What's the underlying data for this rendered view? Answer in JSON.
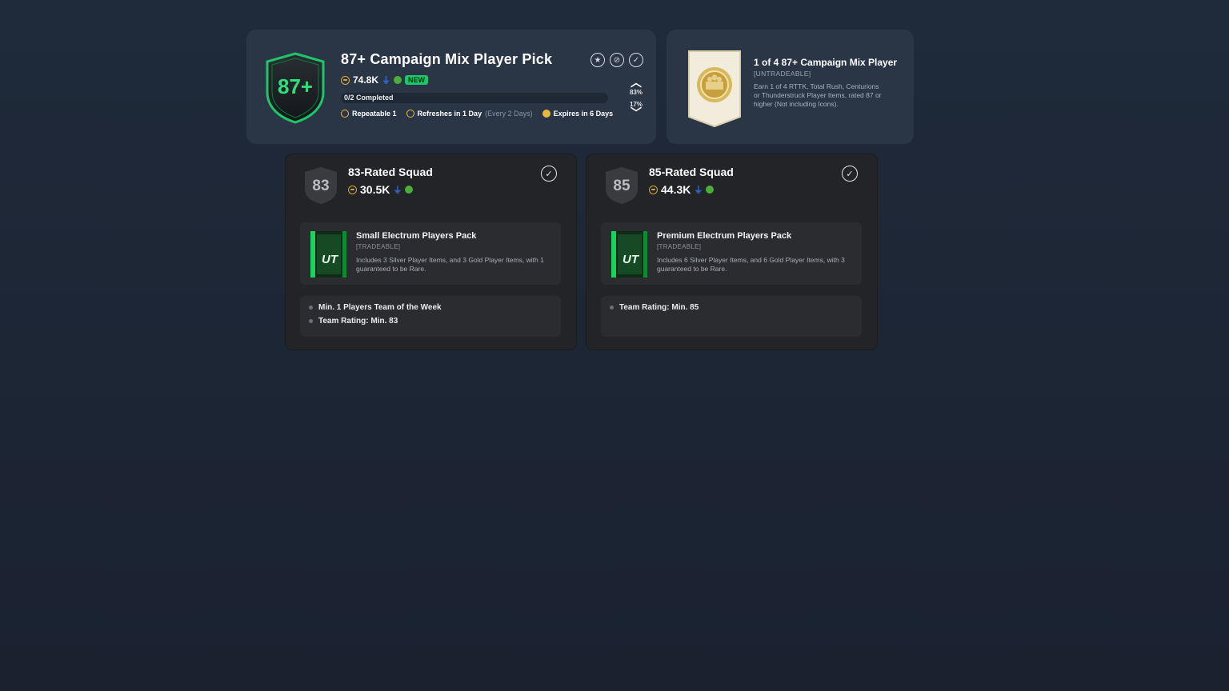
{
  "header": {
    "badge_text": "87+",
    "title": "87+ Campaign Mix Player Pick",
    "cost": "74.8K",
    "new_label": "NEW",
    "progress_text": "0/2 Completed",
    "progress_fraction": 0,
    "repeatable": "Repeatable 1",
    "refreshes": "Refreshes in 1 Day",
    "refresh_every": "(Every 2 Days)",
    "expires": "Expires in 6 Days",
    "vote_up_pct": "83%",
    "vote_down_pct": "17%",
    "icons": [
      "star-circle-icon",
      "hidden-circle-icon",
      "check-circle-icon"
    ]
  },
  "reward": {
    "title": "1 of 4 87+ Campaign Mix Player",
    "tradeable": "[UNTRADEABLE]",
    "description": "Earn 1 of 4 RTTK, Total Rush, Centurions or Thunderstruck Player Items, rated 87 or higher (Not including Icons)."
  },
  "squads": [
    {
      "rating": "83",
      "title": "83-Rated Squad",
      "cost": "30.5K",
      "pack": {
        "title": "Small Electrum Players Pack",
        "tradeable": "[TRADEABLE]",
        "description": "Includes 3 Silver Player Items, and 3 Gold Player Items, with 1 guaranteed to be Rare."
      },
      "requirements": [
        "Min. 1 Players Team of the Week",
        "Team Rating: Min. 83"
      ]
    },
    {
      "rating": "85",
      "title": "85-Rated Squad",
      "cost": "44.3K",
      "pack": {
        "title": "Premium Electrum Players Pack",
        "tradeable": "[TRADEABLE]",
        "description": "Includes 6 Silver Player Items, and 6 Gold Player Items, with 3 guaranteed to be Rare."
      },
      "requirements": [
        "Team Rating: Min. 85"
      ]
    }
  ],
  "colors": {
    "accent_green": "#1ec56a",
    "coin_gold": "#d6a93a",
    "card_bg": "#2a3546",
    "squad_bg": "#232427"
  }
}
